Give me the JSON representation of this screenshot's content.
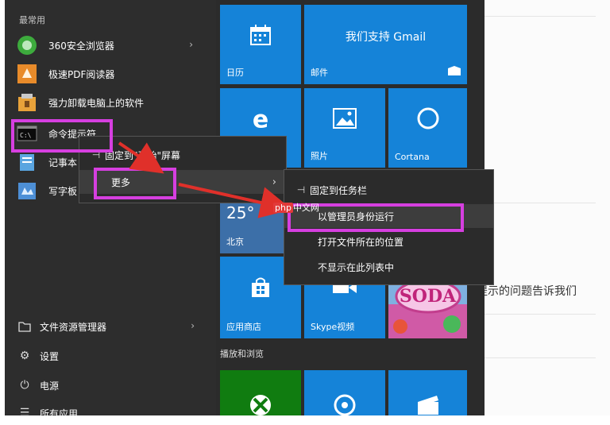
{
  "start_menu": {
    "section_label": "最常用",
    "apps": [
      {
        "name": "360安全浏览器",
        "has_submenu": true
      },
      {
        "name": "极速PDF阅读器",
        "has_submenu": false
      },
      {
        "name": "强力卸载电脑上的软件",
        "has_submenu": false
      },
      {
        "name": "命令提示符",
        "has_submenu": false
      },
      {
        "name": "记事本",
        "has_submenu": false
      },
      {
        "name": "写字板",
        "has_submenu": false
      }
    ],
    "system": [
      {
        "name": "文件资源管理器",
        "icon": "folder-icon"
      },
      {
        "name": "设置",
        "icon": "gear-icon"
      },
      {
        "name": "电源",
        "icon": "power-icon"
      },
      {
        "name": "所有应用",
        "icon": "list-icon"
      }
    ]
  },
  "tiles": {
    "calendar": "日历",
    "mail_title": "我们支持 Gmail",
    "mail": "邮件",
    "edge": "e",
    "photos": "照片",
    "cortana": "Cortana",
    "weather_temp": "25°",
    "weather_city": "北京",
    "store": "应用商店",
    "skype": "Skype视频",
    "candy": "SODA",
    "group2_label": "播放和浏览"
  },
  "context_menu": {
    "pin_start": "固定到\"开始\"屏幕",
    "more": "更多"
  },
  "submenu": {
    "pin_taskbar": "固定到任务栏",
    "run_as_admin": "以管理员身份运行",
    "open_location": "打开文件所在的位置",
    "hide_in_list": "不显示在此列表中"
  },
  "watermark": {
    "brand": "php",
    "text": "中文网"
  },
  "background_text": "提示的问题告诉我们"
}
